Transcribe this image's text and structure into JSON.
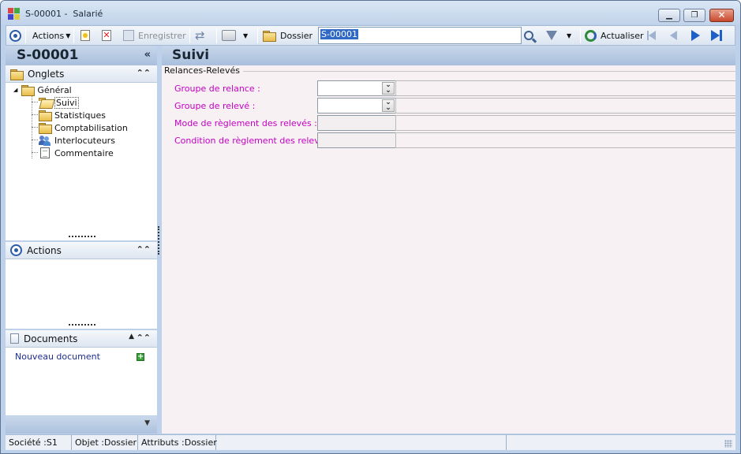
{
  "window": {
    "title": "S-00001 -  Salarié"
  },
  "toolbar": {
    "actions_label": "Actions",
    "save_label": "Enregistrer",
    "folder_label": "Dossier",
    "search_value": "S-00001",
    "refresh_label": "Actualiser"
  },
  "left_panel": {
    "title": "S-00001",
    "tabs_section": "Onglets",
    "tree": {
      "root": "Général",
      "children": [
        "Suivi",
        "Statistiques",
        "Comptabilisation",
        "Interlocuteurs",
        "Commentaire"
      ]
    },
    "actions_section": "Actions",
    "documents_section": "Documents",
    "new_document": "Nouveau document"
  },
  "main": {
    "title": "Suivi",
    "group_title": "Relances-Relevés",
    "fields": [
      {
        "label": "Groupe de relance :",
        "type": "combo",
        "value": ""
      },
      {
        "label": "Groupe de relevé :",
        "type": "combo",
        "value": ""
      },
      {
        "label": "Mode de règlement des relevés :",
        "type": "text",
        "value": ""
      },
      {
        "label": "Condition de règlement des relevés :",
        "type": "text",
        "value": ""
      }
    ]
  },
  "statusbar": {
    "societe": "Société :S1",
    "objet": "Objet :Dossier",
    "attributs": "Attributs :Dossier"
  },
  "colors": {
    "label_magenta": "#c400c4",
    "header_blue": "#a9bfdc",
    "frame_blue": "#bdd1ea",
    "link_blue": "#1d2d8c"
  }
}
